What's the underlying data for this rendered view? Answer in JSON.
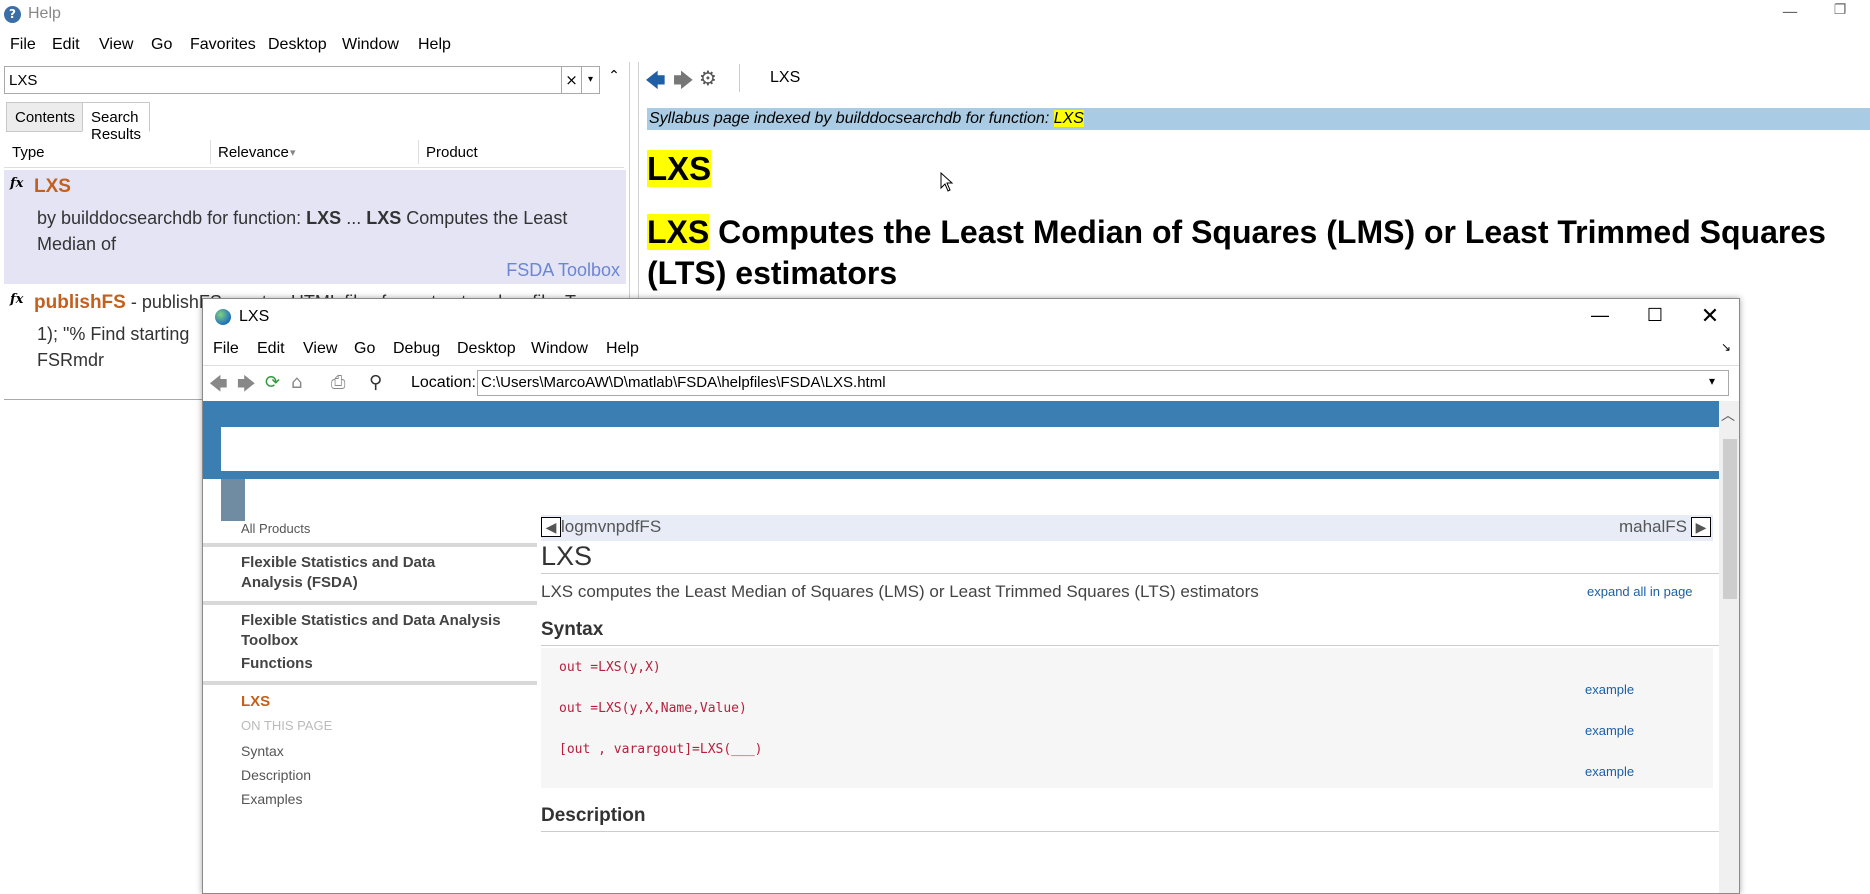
{
  "main_window": {
    "title": "Help",
    "app_icon": "help-icon",
    "controls": {
      "minimize": "—",
      "restore": "❐"
    }
  },
  "menubar": [
    "File",
    "Edit",
    "View",
    "Go",
    "Favorites",
    "Desktop",
    "Window",
    "Help"
  ],
  "left_pane": {
    "search": {
      "value": "LXS",
      "clear": "×",
      "dropdown": "▾",
      "collapse": "⌃"
    },
    "tabs": [
      {
        "label": "Contents",
        "active": false
      },
      {
        "label": "Search Results",
        "active": true
      }
    ],
    "columns": [
      "Type",
      "Relevance",
      "Product"
    ],
    "sort_indicator": "▾",
    "results": [
      {
        "icon": "fx",
        "title": "LXS",
        "snippet_line1_prefix": "by builddocsearchdb for function: ",
        "snippet_bold1": "LXS",
        "snippet_middle": " ... ",
        "snippet_bold2": "LXS",
        "snippet_line1_suffix": " Computes the Least",
        "snippet_line2": "Median of",
        "product": "FSDA Toolbox"
      },
      {
        "icon": "fx",
        "title": "publishFS",
        "title_suffix": " - publishFS creates HTML files from structured .m file. T",
        "line2": "1); \"% Find starting",
        "line3": "FSRmdr"
      }
    ]
  },
  "right_pane": {
    "address": "LXS",
    "syllabus_prefix": "Syllabus page indexed by builddocsearchdb for function: ",
    "syllabus_hl": "LXS",
    "heading1": "LXS",
    "heading2_hl": "LXS",
    "heading2_rest": " Computes the Least Median of Squares (LMS) or Least Trimmed Squares (LTS) estimators"
  },
  "lxs_window": {
    "title": "LXS",
    "controls": {
      "minimize": "—",
      "maximize": "☐",
      "close": "✕"
    },
    "menubar": [
      "File",
      "Edit",
      "View",
      "Go",
      "Debug",
      "Desktop",
      "Window",
      "Help"
    ],
    "location_label": "Location:",
    "location_value": "C:\\Users\\MarcoAW\\D\\matlab\\FSDA\\helpfiles\\FSDA\\LXS.html",
    "nav": {
      "all_products": "All Products",
      "fsda": "Flexible Statistics and Data Analysis (FSDA)",
      "toolbox": "Flexible Statistics and Data Analysis Toolbox",
      "functions": "Functions",
      "current": "LXS",
      "on_this_page": "ON THIS PAGE",
      "syntax": "Syntax",
      "description": "Description",
      "examples": "Examples"
    },
    "page": {
      "prev": "logmvnpdfFS",
      "next": "mahalFS",
      "title": "LXS",
      "summary": "LXS computes the Least Median of Squares (LMS) or Least Trimmed Squares (LTS) estimators",
      "expand_all": "expand all in page",
      "syntax_heading": "Syntax",
      "syntax_lines": [
        "out =LXS(y,X)",
        "out =LXS(y,X,Name,Value)",
        "[out , varargout]=LXS(___)"
      ],
      "example_label": "example",
      "description_heading": "Description"
    }
  }
}
